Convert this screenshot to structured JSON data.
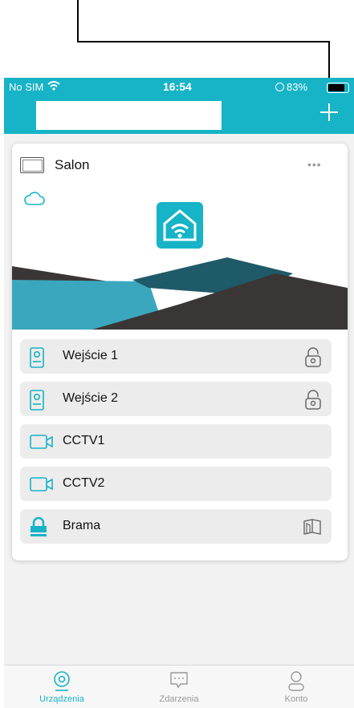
{
  "statusbar": {
    "carrier": "No SIM",
    "time": "16:54",
    "battery": "83%"
  },
  "header": {
    "add_icon": "plus-icon"
  },
  "card": {
    "title": "Salon",
    "more": "•••"
  },
  "rows": [
    {
      "label": "Wejście 1",
      "icon": "intercom-icon",
      "right_icon": "lock-icon"
    },
    {
      "label": "Wejście 2",
      "icon": "intercom-icon",
      "right_icon": "lock-icon"
    },
    {
      "label": "CCTV1",
      "icon": "camera-icon"
    },
    {
      "label": "CCTV2",
      "icon": "camera-icon"
    },
    {
      "label": "Brama",
      "icon": "padlock-icon",
      "right_icon": "gate-icon"
    }
  ],
  "tabs": [
    {
      "label": "Urządzenia",
      "active": true
    },
    {
      "label": "Zdarzenia",
      "active": false
    },
    {
      "label": "Konto",
      "active": false
    }
  ],
  "colors": {
    "accent": "#17b3c6",
    "dark": "#3a3636",
    "teal_dark": "#1f5a68"
  }
}
